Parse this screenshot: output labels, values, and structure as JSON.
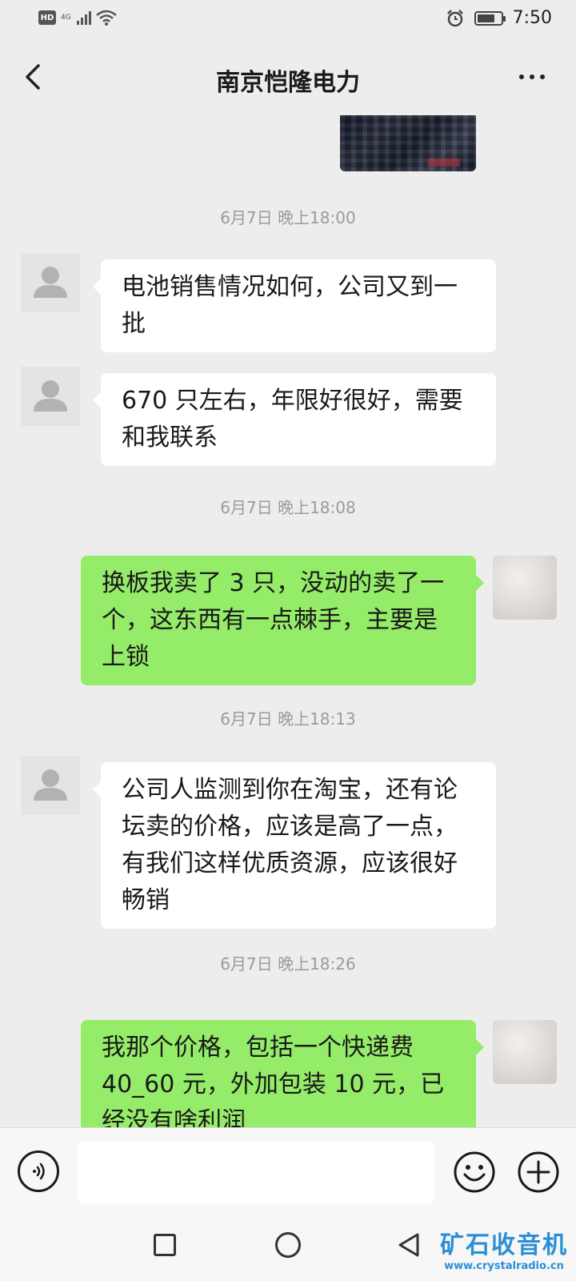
{
  "status_bar": {
    "hd": "HD",
    "network": "4G",
    "time": "7:50",
    "battery_level": 0.75
  },
  "header": {
    "title": "南京恺隆电力"
  },
  "messages": [
    {
      "type": "timestamp",
      "text": "6月7日 晚上18:00"
    },
    {
      "type": "incoming",
      "text": "电池销售情况如何，公司又到一批"
    },
    {
      "type": "incoming",
      "text": "670 只左右，年限好很好，需要和我联系"
    },
    {
      "type": "timestamp",
      "text": "6月7日 晚上18:08"
    },
    {
      "type": "outgoing",
      "text": "换板我卖了 3 只，没动的卖了一个，这东西有一点棘手，主要是上锁"
    },
    {
      "type": "timestamp",
      "text": "6月7日 晚上18:13"
    },
    {
      "type": "incoming",
      "text": "公司人监测到你在淘宝，还有论坛卖的价格，应该是高了一点，有我们这样优质资源，应该很好畅销"
    },
    {
      "type": "timestamp",
      "text": "6月7日 晚上18:26"
    },
    {
      "type": "outgoing",
      "text": "我那个价格，包括一个快递费40_60 元，外加包装 10 元，已经没有啥利润"
    }
  ],
  "input": {
    "value": "",
    "placeholder": ""
  },
  "icons": {
    "back": "back-arrow-icon",
    "more": "more-icon",
    "voice": "voice-icon",
    "emoji": "emoji-icon",
    "plus": "plus-icon"
  },
  "watermark": {
    "title": "矿石收音机",
    "url": "www.crystalradio.cn"
  },
  "colors": {
    "background": "#ededed",
    "outgoing_bubble": "#95ec69",
    "incoming_bubble": "#ffffff",
    "watermark": "#2a8fd6"
  }
}
